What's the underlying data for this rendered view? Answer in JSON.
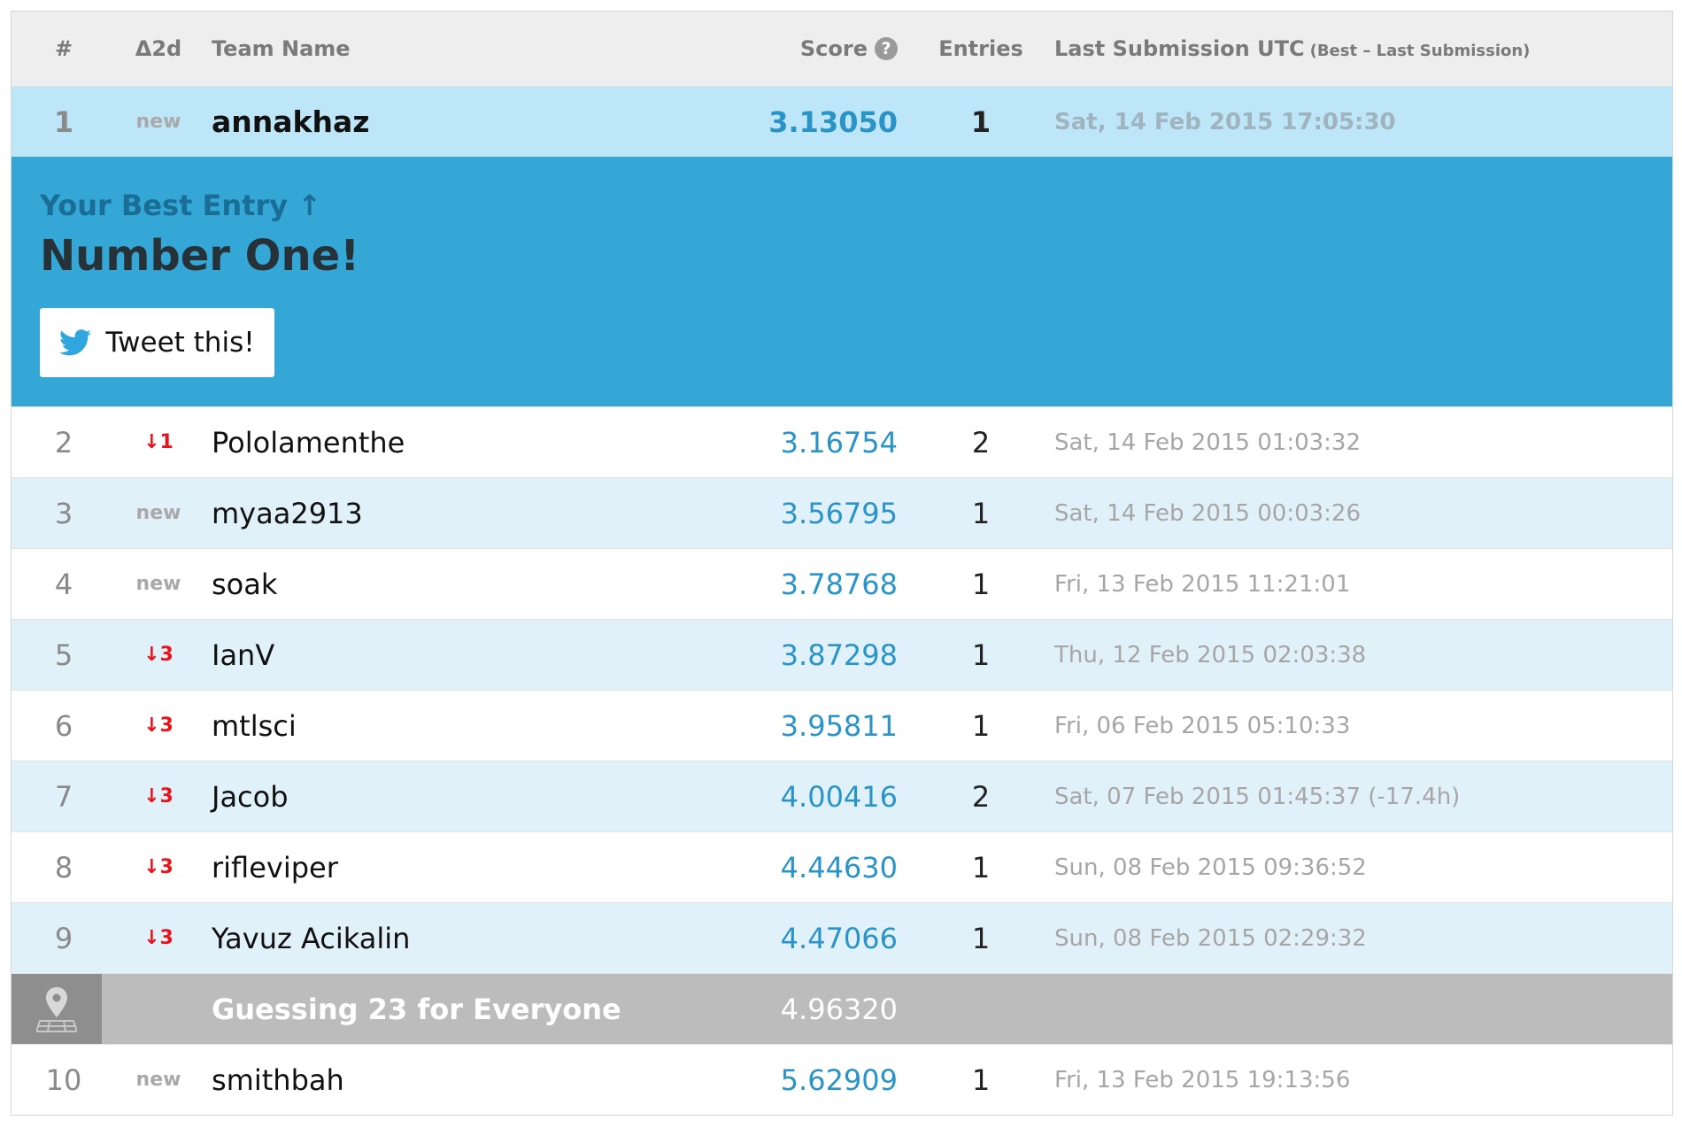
{
  "header": {
    "rank": "#",
    "delta": "Δ2d",
    "team": "Team Name",
    "score": "Score",
    "entries": "Entries",
    "last": "Last Submission UTC",
    "last_sub": "(Best – Last Submission)"
  },
  "me": {
    "rank": "1",
    "delta": "new",
    "name": "annakhaz",
    "score": "3.13050",
    "entries": "1",
    "date": "Sat, 14 Feb 2015 17:05:30"
  },
  "banner": {
    "label": "Your Best Entry ↑",
    "title": "Number One!",
    "tweet": "Tweet this!"
  },
  "rows": [
    {
      "rank": "2",
      "delta": "↓1",
      "name": "Pololamenthe",
      "score": "3.16754",
      "entries": "2",
      "date": "Sat, 14 Feb 2015 01:03:32"
    },
    {
      "rank": "3",
      "delta": "new",
      "name": "myaa2913",
      "score": "3.56795",
      "entries": "1",
      "date": "Sat, 14 Feb 2015 00:03:26"
    },
    {
      "rank": "4",
      "delta": "new",
      "name": "soak",
      "score": "3.78768",
      "entries": "1",
      "date": "Fri, 13 Feb 2015 11:21:01"
    },
    {
      "rank": "5",
      "delta": "↓3",
      "name": "IanV",
      "score": "3.87298",
      "entries": "1",
      "date": "Thu, 12 Feb 2015 02:03:38"
    },
    {
      "rank": "6",
      "delta": "↓3",
      "name": "mtlsci",
      "score": "3.95811",
      "entries": "1",
      "date": "Fri, 06 Feb 2015 05:10:33"
    },
    {
      "rank": "7",
      "delta": "↓3",
      "name": "Jacob",
      "score": "4.00416",
      "entries": "2",
      "date": "Sat, 07 Feb 2015 01:45:37 (-17.4h)"
    },
    {
      "rank": "8",
      "delta": "↓3",
      "name": "rifleviper",
      "score": "4.44630",
      "entries": "1",
      "date": "Sun, 08 Feb 2015 09:36:52"
    },
    {
      "rank": "9",
      "delta": "↓3",
      "name": "Yavuz Acikalin",
      "score": "4.47066",
      "entries": "1",
      "date": "Sun, 08 Feb 2015 02:29:32"
    }
  ],
  "benchmark": {
    "name": "Guessing 23 for Everyone",
    "score": "4.96320",
    "icon": "map-pin-icon"
  },
  "last_row": {
    "rank": "10",
    "delta": "new",
    "name": "smithbah",
    "score": "5.62909",
    "entries": "1",
    "date": "Fri, 13 Feb 2015 19:13:56"
  },
  "colors": {
    "score_blue": "#2a94c8",
    "banner_blue": "#34a7d6",
    "highlight_row": "#bde6f8",
    "alt_row": "#e1f1fa",
    "down_red": "#e8141c",
    "benchmark_gray": "#bcbcbc"
  }
}
